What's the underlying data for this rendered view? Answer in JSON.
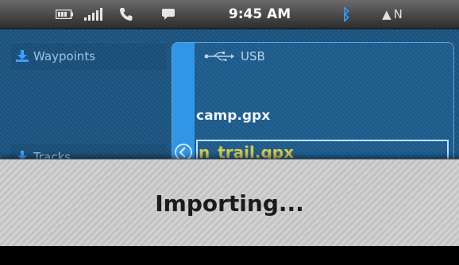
{
  "status_bar": {
    "time": "9:45 AM",
    "compass_letter": "N",
    "compass_arrow": "▲",
    "bluetooth_glyph": "ᛒ",
    "icons": [
      "battery-icon",
      "signal-icon",
      "phone-icon",
      "chat-icon",
      "bluetooth-icon",
      "north-arrow-icon"
    ]
  },
  "sidebar": {
    "items": [
      {
        "label": "Waypoints",
        "icon": "download-icon"
      },
      {
        "label": "Tracks",
        "icon": "download-icon"
      }
    ]
  },
  "usb_panel": {
    "title": "USB",
    "files": [
      "camp.gpx",
      "n_trail.gpx"
    ],
    "selected_index": 1
  },
  "overlay": {
    "message": "Importing..."
  },
  "colors": {
    "accent_blue": "#3296e6",
    "panel_bg": "#1b5582",
    "selected_text": "#d6c94a",
    "bluetooth": "#2e9bff"
  }
}
